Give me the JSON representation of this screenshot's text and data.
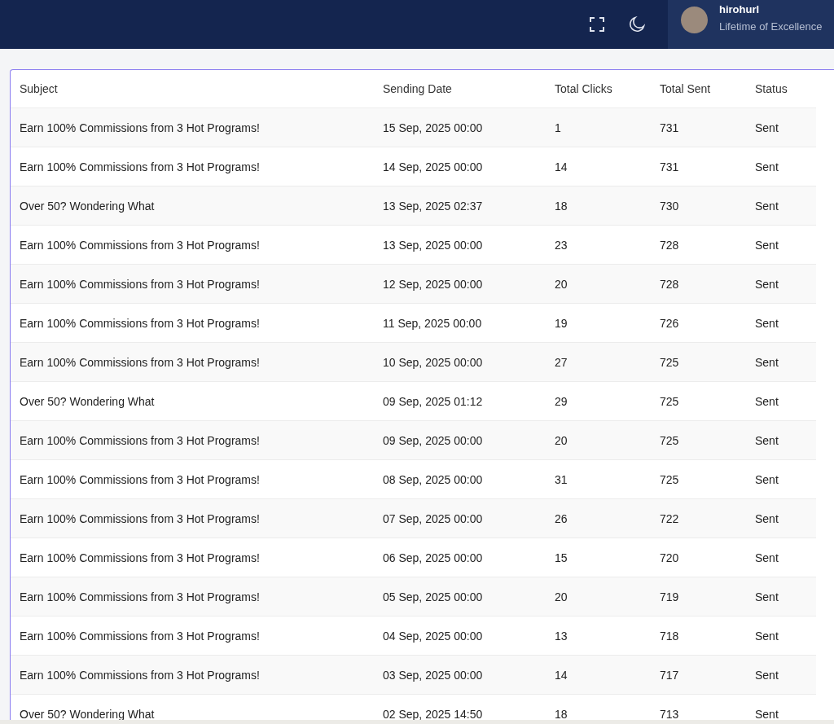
{
  "header": {
    "user": {
      "name": "hirohurl",
      "subtitle": "Lifetime of Excellence"
    }
  },
  "table": {
    "columns": [
      "Subject",
      "Sending Date",
      "Total Clicks",
      "Total Sent",
      "Status"
    ],
    "rows": [
      [
        "Earn 100% Commissions from 3 Hot Programs!",
        "15 Sep, 2025 00:00",
        "1",
        "731",
        "Sent"
      ],
      [
        "Earn 100% Commissions from 3 Hot Programs!",
        "14 Sep, 2025 00:00",
        "14",
        "731",
        "Sent"
      ],
      [
        "Over 50? Wondering What",
        "13 Sep, 2025 02:37",
        "18",
        "730",
        "Sent"
      ],
      [
        "Earn 100% Commissions from 3 Hot Programs!",
        "13 Sep, 2025 00:00",
        "23",
        "728",
        "Sent"
      ],
      [
        "Earn 100% Commissions from 3 Hot Programs!",
        "12 Sep, 2025 00:00",
        "20",
        "728",
        "Sent"
      ],
      [
        "Earn 100% Commissions from 3 Hot Programs!",
        "11 Sep, 2025 00:00",
        "19",
        "726",
        "Sent"
      ],
      [
        "Earn 100% Commissions from 3 Hot Programs!",
        "10 Sep, 2025 00:00",
        "27",
        "725",
        "Sent"
      ],
      [
        "Over 50? Wondering What",
        "09 Sep, 2025 01:12",
        "29",
        "725",
        "Sent"
      ],
      [
        "Earn 100% Commissions from 3 Hot Programs!",
        "09 Sep, 2025 00:00",
        "20",
        "725",
        "Sent"
      ],
      [
        "Earn 100% Commissions from 3 Hot Programs!",
        "08 Sep, 2025 00:00",
        "31",
        "725",
        "Sent"
      ],
      [
        "Earn 100% Commissions from 3 Hot Programs!",
        "07 Sep, 2025 00:00",
        "26",
        "722",
        "Sent"
      ],
      [
        "Earn 100% Commissions from 3 Hot Programs!",
        "06 Sep, 2025 00:00",
        "15",
        "720",
        "Sent"
      ],
      [
        "Earn 100% Commissions from 3 Hot Programs!",
        "05 Sep, 2025 00:00",
        "20",
        "719",
        "Sent"
      ],
      [
        "Earn 100% Commissions from 3 Hot Programs!",
        "04 Sep, 2025 00:00",
        "13",
        "718",
        "Sent"
      ],
      [
        "Earn 100% Commissions from 3 Hot Programs!",
        "03 Sep, 2025 00:00",
        "14",
        "717",
        "Sent"
      ],
      [
        "Over 50? Wondering What",
        "02 Sep, 2025 14:50",
        "18",
        "713",
        "Sent"
      ]
    ]
  }
}
